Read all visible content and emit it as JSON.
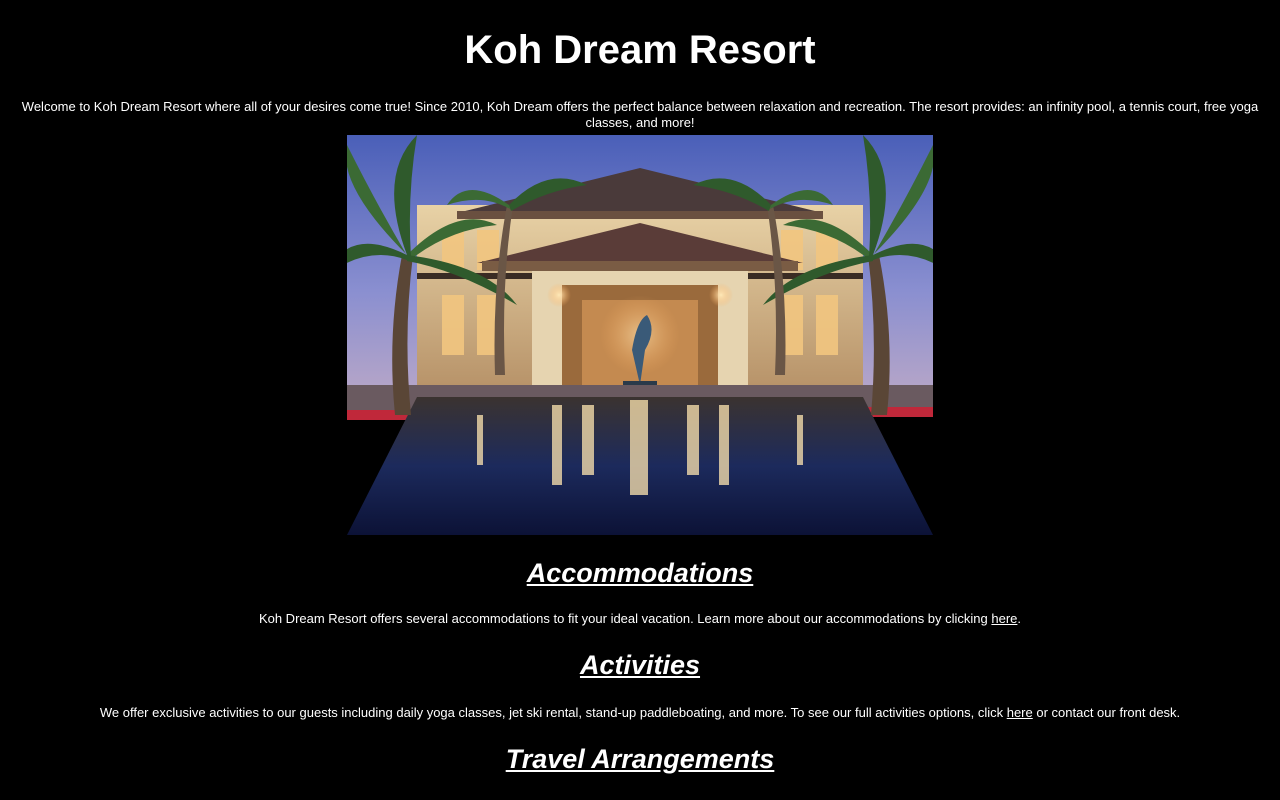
{
  "page": {
    "title": "Koh Dream Resort",
    "intro": "Welcome to Koh Dream Resort where all of your desires come true! Since 2010, Koh Dream offers the perfect balance between relaxation and recreation. The resort provides: an infinity pool, a tennis court, free yoga classes, and more!"
  },
  "hero_image": {
    "description": "resort-lobby-infinity-pool-dusk"
  },
  "sections": {
    "accommodations": {
      "heading": "Accommodations",
      "text_before": "Koh Dream Resort offers several accommodations to fit your ideal vacation. Learn more about our accommodations by clicking ",
      "link": "here",
      "text_after": "."
    },
    "activities": {
      "heading": "Activities",
      "text_before": "We offer exclusive activities to our guests including daily yoga classes, jet ski rental, stand-up paddleboating, and more. To see our full activities options, click ",
      "link": "here",
      "text_after": " or contact our front desk."
    },
    "travel": {
      "heading": "Travel Arrangements"
    }
  },
  "colors": {
    "background": "#000000",
    "text": "#ffffff"
  }
}
